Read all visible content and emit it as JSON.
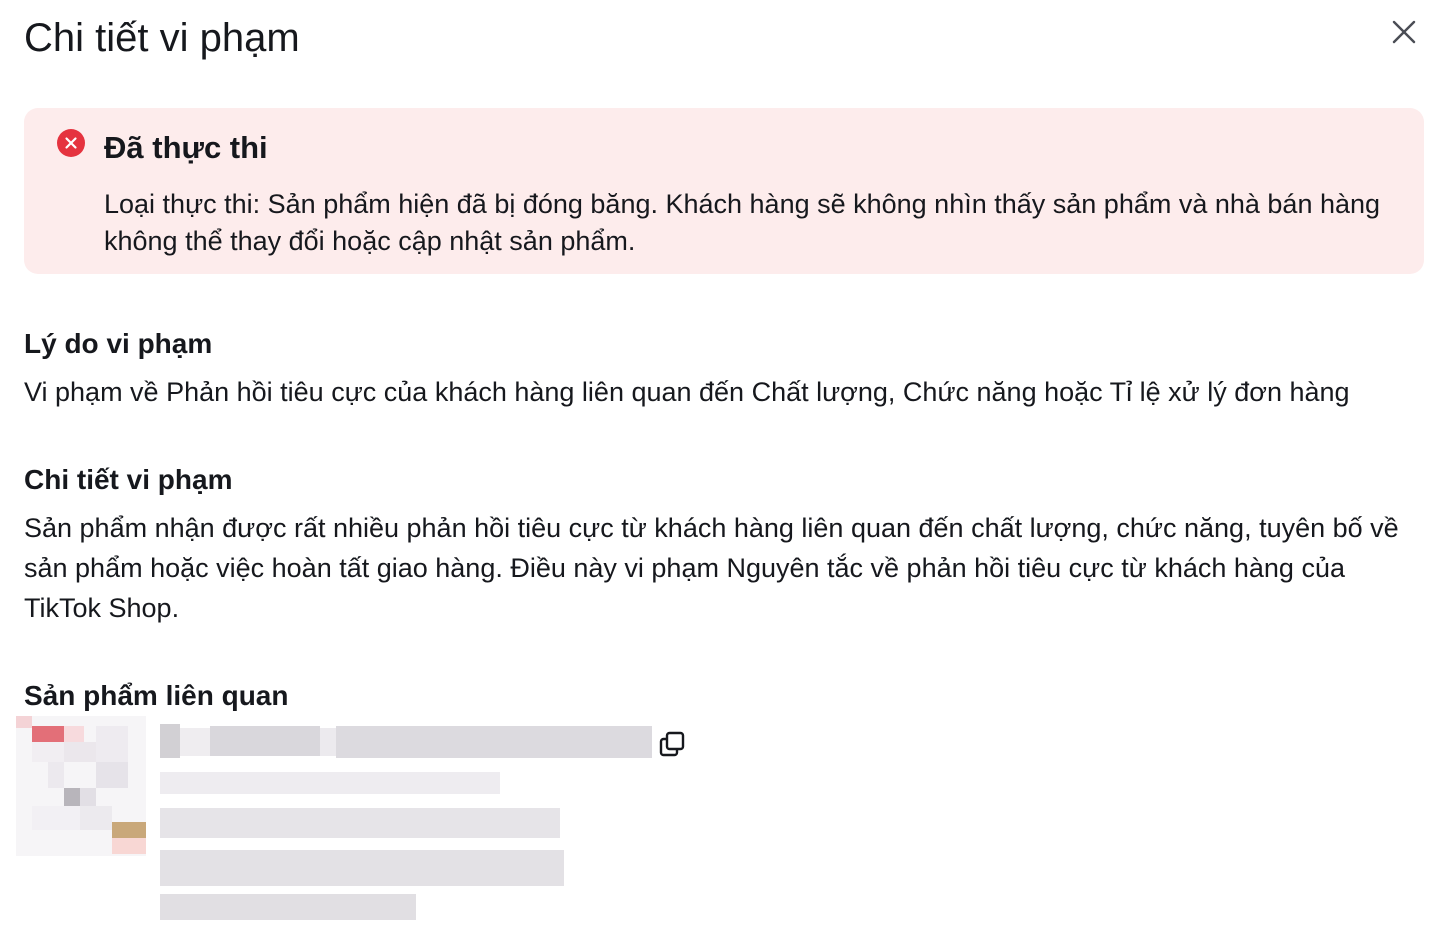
{
  "dialog": {
    "title": "Chi tiết vi phạm",
    "close_icon": "close-icon"
  },
  "alert": {
    "icon": "error-circle-icon",
    "title": "Đã thực thi",
    "body": "Loại thực thi: Sản phẩm hiện đã bị đóng băng. Khách hàng sẽ không nhìn thấy sản phẩm và nhà bán hàng không thể thay đổi hoặc cập nhật sản phẩm.",
    "background_color": "#fdecec",
    "icon_color": "#e5333f"
  },
  "reason": {
    "heading": "Lý do vi phạm",
    "text": "Vi phạm về Phản hồi tiêu cực của khách hàng liên quan đến Chất lượng, Chức năng hoặc Tỉ lệ xử lý đơn hàng"
  },
  "details": {
    "heading": "Chi tiết vi phạm",
    "text": "Sản phẩm nhận được rất nhiều phản hồi tiêu cực từ khách hàng liên quan đến chất lượng, chức năng, tuyên bố về sản phẩm hoặc việc hoàn tất giao hàng. Điều này vi phạm Nguyên tắc về phản hồi tiêu cực từ khách hàng của TikTok Shop."
  },
  "related_products": {
    "heading": "Sản phẩm liên quan",
    "copy_icon": "copy-icon",
    "product_image": "blurred-product-thumbnail",
    "product_text": "blurred-product-details"
  }
}
